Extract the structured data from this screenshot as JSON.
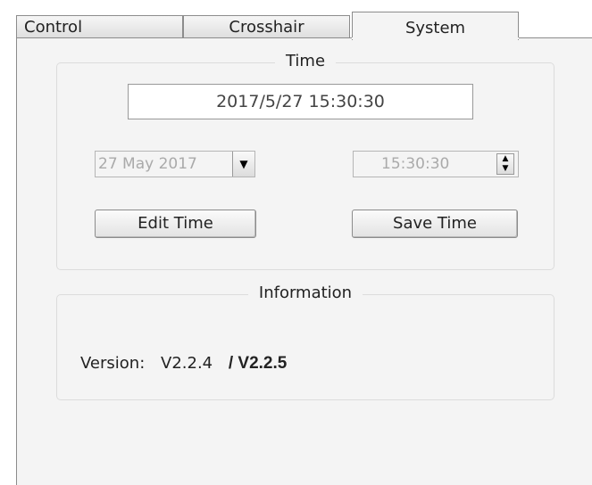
{
  "tabs": [
    {
      "label": "Control",
      "active": false
    },
    {
      "label": "Crosshair",
      "active": false
    },
    {
      "label": "System",
      "active": true
    }
  ],
  "time_group": {
    "title": "Time",
    "datetime_display": "2017/5/27  15:30:30",
    "date_picker_value": "27 May 2017",
    "time_spinner_value": "15:30:30",
    "edit_button_label": "Edit Time",
    "save_button_label": "Save Time",
    "icons": {
      "date_dropdown": "chevron-down-icon",
      "time_spinner": "spin-up-down-icon"
    }
  },
  "info_group": {
    "title": "Information",
    "version_label": "Version:",
    "version_current": "V2.2.4",
    "version_new": "/ V2.2.5"
  },
  "colors": {
    "panel_bg": "#f4f4f4",
    "disabled_text": "#aaaaaa",
    "border": "#8c8c8c"
  }
}
